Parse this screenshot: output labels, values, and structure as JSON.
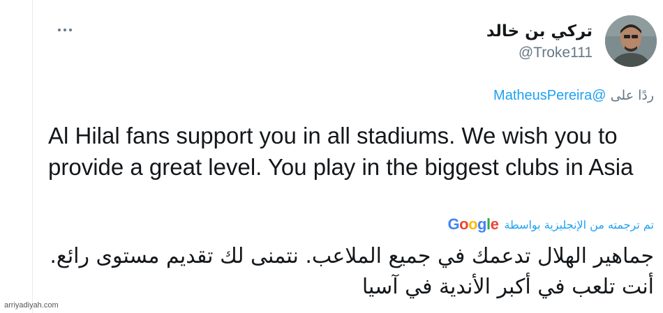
{
  "author": {
    "display_name": "تركي بن خالد",
    "handle": "@Troke111",
    "avatar_icon": "user-avatar-photo"
  },
  "more_icon": "ellipsis-icon",
  "reply": {
    "prefix": "ردًا على",
    "mention": "@MatheusPereira"
  },
  "tweet": {
    "text": "Al Hilal fans support you in all stadiums. We wish you to provide a great level. You play in the biggest clubs in Asia"
  },
  "translation": {
    "label": "تم ترجمته من الإنجليزية بواسطة",
    "provider": "Google",
    "provider_colors": [
      "#4285F4",
      "#EA4335",
      "#FBBC05",
      "#4285F4",
      "#34A853",
      "#EA4335"
    ],
    "text": "جماهير الهلال تدعمك في جميع الملاعب. نتمنى لك تقديم مستوى رائع. أنت تلعب في أكبر الأندية في آسيا"
  },
  "watermark": "arriyadiyah.com",
  "colors": {
    "accent": "#1da1f2",
    "text": "#14171a",
    "muted": "#657786"
  }
}
